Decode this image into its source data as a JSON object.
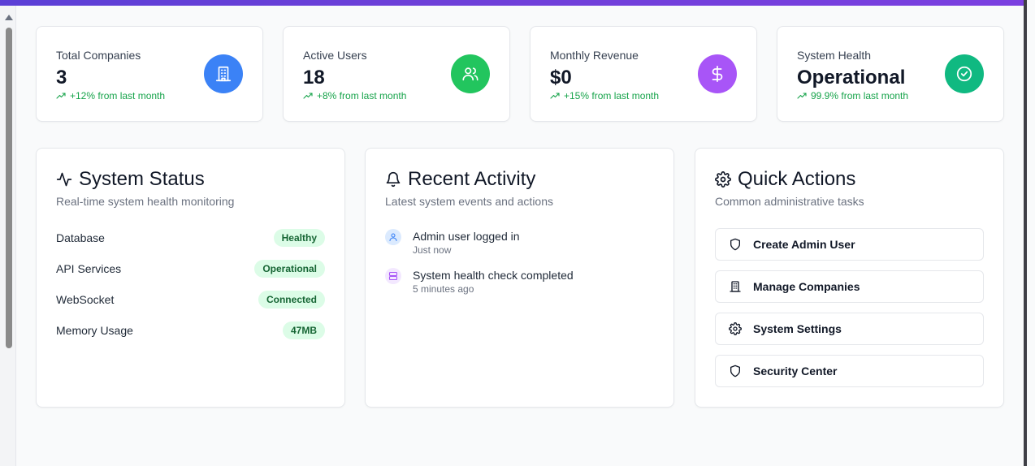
{
  "stats": [
    {
      "label": "Total Companies",
      "value": "3",
      "trend": "+12% from last month",
      "icon": "building-icon",
      "color": "#3b82f6"
    },
    {
      "label": "Active Users",
      "value": "18",
      "trend": "+8% from last month",
      "icon": "users-icon",
      "color": "#22c55e"
    },
    {
      "label": "Monthly Revenue",
      "value": "$0",
      "trend": "+15% from last month",
      "icon": "dollar-icon",
      "color": "#a855f7"
    },
    {
      "label": "System Health",
      "value": "Operational",
      "trend": "99.9% from last month",
      "icon": "check-circle-icon",
      "color": "#10b981"
    }
  ],
  "system_status": {
    "title": "System Status",
    "subtitle": "Real-time system health monitoring",
    "rows": [
      {
        "label": "Database",
        "badge": "Healthy"
      },
      {
        "label": "API Services",
        "badge": "Operational"
      },
      {
        "label": "WebSocket",
        "badge": "Connected"
      },
      {
        "label": "Memory Usage",
        "badge": "47MB"
      }
    ]
  },
  "recent_activity": {
    "title": "Recent Activity",
    "subtitle": "Latest system events and actions",
    "items": [
      {
        "title": "Admin user logged in",
        "time": "Just now",
        "icon": "user-icon"
      },
      {
        "title": "System health check completed",
        "time": "5 minutes ago",
        "icon": "server-icon"
      }
    ]
  },
  "quick_actions": {
    "title": "Quick Actions",
    "subtitle": "Common administrative tasks",
    "actions": [
      {
        "label": "Create Admin User",
        "icon": "shield-icon"
      },
      {
        "label": "Manage Companies",
        "icon": "building-icon"
      },
      {
        "label": "System Settings",
        "icon": "gear-icon"
      },
      {
        "label": "Security Center",
        "icon": "shield-icon"
      }
    ]
  },
  "colors": {
    "accent_bar": "#6d3fd8",
    "trend_green": "#16a34a",
    "badge_bg": "#dcfce7",
    "badge_text": "#166534"
  }
}
